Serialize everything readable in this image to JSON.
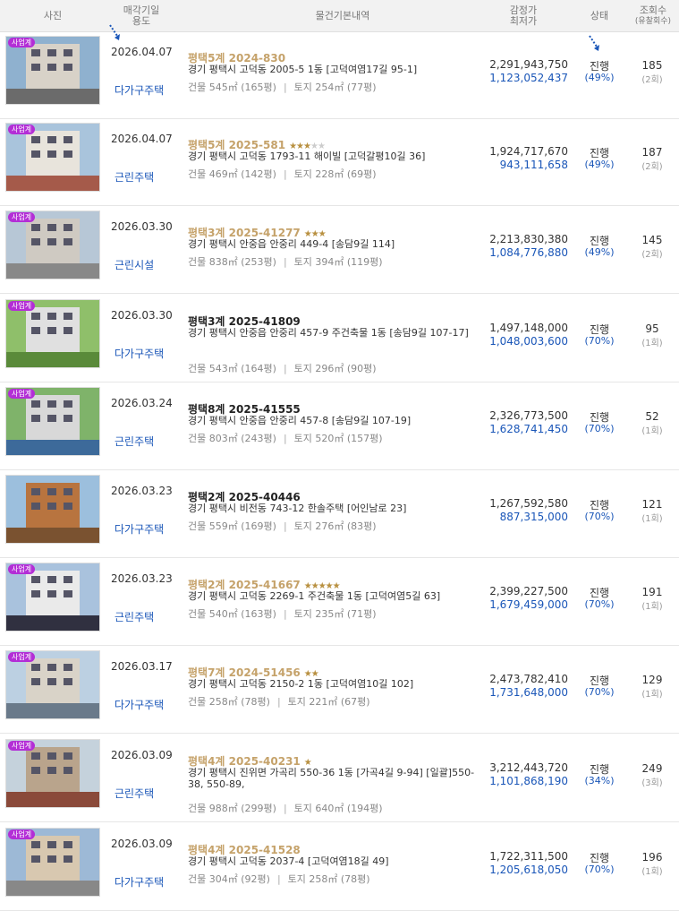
{
  "header": {
    "photo": "사진",
    "date_line1": "매각기일",
    "date_line2": "용도",
    "details": "물건기본내역",
    "price_line1": "감정가",
    "price_line2": "최저가",
    "status": "상태",
    "views_line1": "조회수",
    "views_line2": "(유찰회수)"
  },
  "colors": {
    "accent": "#1a56b8",
    "tag": "#b32ed6",
    "title_gold": "#c5a26a"
  },
  "rows": [
    {
      "tag": "사업계",
      "date": "2026.04.07",
      "use": "다가구주택",
      "title": "평택5계 2024-830",
      "stars": 0,
      "plain": false,
      "addr": "경기 평택시 고덕동 2005-5 1동 [고덕여염17길 95-1]",
      "bldg": "건물 545㎡ (165평)",
      "land": "토지 254㎡ (77평)",
      "appraisal": "2,291,943,750",
      "minimum": "1,123,052,437",
      "status": "진행",
      "pct": "(49%)",
      "views": "185",
      "fails": "(2회)"
    },
    {
      "tag": "사업계",
      "date": "2026.04.07",
      "use": "근린주택",
      "title": "평택5계 2025-581",
      "stars": 3,
      "plain": false,
      "addr": "경기 평택시 고덕동 1793-11 해이빌 [고덕갈평10길 36]",
      "bldg": "건물 469㎡ (142평)",
      "land": "토지 228㎡ (69평)",
      "appraisal": "1,924,717,670",
      "minimum": "943,111,658",
      "status": "진행",
      "pct": "(49%)",
      "views": "187",
      "fails": "(2회)"
    },
    {
      "tag": "사업계",
      "date": "2026.03.30",
      "use": "근린시설",
      "title": "평택3계 2025-41277",
      "stars": 3,
      "plain": false,
      "addr": "경기 평택시 안중읍 안중리 449-4 [송담9길 114]",
      "bldg": "건물 838㎡ (253평)",
      "land": "토지 394㎡ (119평)",
      "appraisal": "2,213,830,380",
      "minimum": "1,084,776,880",
      "status": "진행",
      "pct": "(49%)",
      "views": "145",
      "fails": "(2회)"
    },
    {
      "tag": "사업계",
      "date": "2026.03.30",
      "use": "다가구주택",
      "title": "평택3계 2025-41809",
      "stars": 0,
      "plain": true,
      "addr": "경기 평택시 안중읍 안중리 457-9 주건축물 1동 [송담9길 107-17]",
      "bldg": "건물 543㎡ (164평)",
      "land": "토지 296㎡ (90평)",
      "appraisal": "1,497,148,000",
      "minimum": "1,048,003,600",
      "status": "진행",
      "pct": "(70%)",
      "views": "95",
      "fails": "(1회)"
    },
    {
      "tag": "사업계",
      "date": "2026.03.24",
      "use": "근린주택",
      "title": "평택8계 2025-41555",
      "stars": 0,
      "plain": true,
      "addr": "경기 평택시 안중읍 안중리 457-8 [송담9길 107-19]",
      "bldg": "건물 803㎡ (243평)",
      "land": "토지 520㎡ (157평)",
      "appraisal": "2,326,773,500",
      "minimum": "1,628,741,450",
      "status": "진행",
      "pct": "(70%)",
      "views": "52",
      "fails": "(1회)"
    },
    {
      "tag": "",
      "date": "2026.03.23",
      "use": "다가구주택",
      "title": "평택2계 2025-40446",
      "stars": 0,
      "plain": true,
      "addr": "경기 평택시 비전동 743-12 한솔주택 [어인남로 23]",
      "bldg": "건물 559㎡ (169평)",
      "land": "토지 276㎡ (83평)",
      "appraisal": "1,267,592,580",
      "minimum": "887,315,000",
      "status": "진행",
      "pct": "(70%)",
      "views": "121",
      "fails": "(1회)"
    },
    {
      "tag": "사업계",
      "date": "2026.03.23",
      "use": "근린주택",
      "title": "평택2계 2025-41667",
      "stars": 5,
      "plain": false,
      "addr": "경기 평택시 고덕동 2269-1 주건축물 1동 [고덕여염5길 63]",
      "bldg": "건물 540㎡ (163평)",
      "land": "토지 235㎡ (71평)",
      "appraisal": "2,399,227,500",
      "minimum": "1,679,459,000",
      "status": "진행",
      "pct": "(70%)",
      "views": "191",
      "fails": "(1회)"
    },
    {
      "tag": "사업계",
      "date": "2026.03.17",
      "use": "다가구주택",
      "title": "평택7계 2024-51456",
      "stars": 2,
      "plain": false,
      "addr": "경기 평택시 고덕동 2150-2 1동 [고덕여염10길 102]",
      "bldg": "건물 258㎡ (78평)",
      "land": "토지 221㎡ (67평)",
      "appraisal": "2,473,782,410",
      "minimum": "1,731,648,000",
      "status": "진행",
      "pct": "(70%)",
      "views": "129",
      "fails": "(1회)"
    },
    {
      "tag": "사업계",
      "date": "2026.03.09",
      "use": "근린주택",
      "title": "평택4계 2025-40231",
      "stars": 1,
      "plain": false,
      "addr": "경기 평택시 진위면 가곡리 550-36 1동 [가곡4길 9-94] [일괄]550-38, 550-89,",
      "bldg": "건물 988㎡ (299평)",
      "land": "토지 640㎡ (194평)",
      "appraisal": "3,212,443,720",
      "minimum": "1,101,868,190",
      "status": "진행",
      "pct": "(34%)",
      "views": "249",
      "fails": "(3회)"
    },
    {
      "tag": "사업계",
      "date": "2026.03.09",
      "use": "다가구주택",
      "title": "평택4계 2025-41528",
      "stars": 0,
      "plain": false,
      "addr": "경기 평택시 고덕동 2037-4 [고덕여염18길 49]",
      "bldg": "건물 304㎡ (92평)",
      "land": "토지 258㎡ (78평)",
      "appraisal": "1,722,311,500",
      "minimum": "1,205,618,050",
      "status": "진행",
      "pct": "(70%)",
      "views": "196",
      "fails": "(1회)"
    }
  ]
}
